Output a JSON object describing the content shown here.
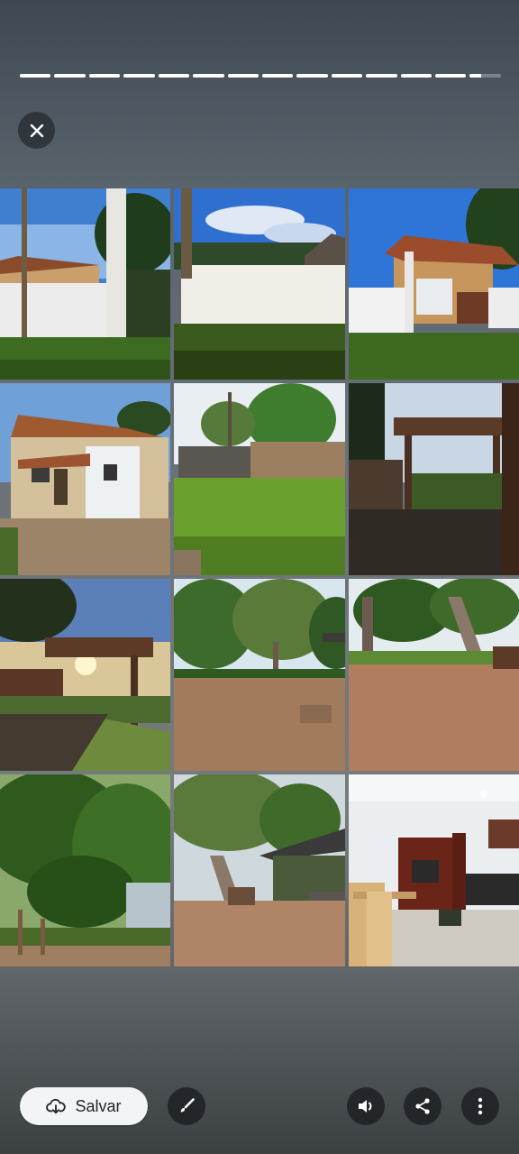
{
  "story": {
    "segments_total": 14,
    "current_segment": 14,
    "current_segment_progress": 0.35
  },
  "toolbar": {
    "close_icon": "close-icon",
    "save_label": "Salvar",
    "save_icon": "cloud-download-icon",
    "edit_icon": "brush-icon",
    "volume_icon": "volume-icon",
    "share_icon": "share-icon",
    "more_icon": "more-vertical-icon"
  },
  "collage": {
    "rows": 4,
    "columns": 3,
    "photos": [
      {
        "subject": "house-facade-with-palm"
      },
      {
        "subject": "white-wall-blue-sky"
      },
      {
        "subject": "gate-pergola"
      },
      {
        "subject": "house-with-yard"
      },
      {
        "subject": "lawn-with-tree"
      },
      {
        "subject": "pergola-sunset"
      },
      {
        "subject": "sunburst-pergola"
      },
      {
        "subject": "dirt-yard-with-trees"
      },
      {
        "subject": "yard-trees"
      },
      {
        "subject": "leafy-trees"
      },
      {
        "subject": "tree-and-shed"
      },
      {
        "subject": "living-room-interior"
      }
    ]
  }
}
